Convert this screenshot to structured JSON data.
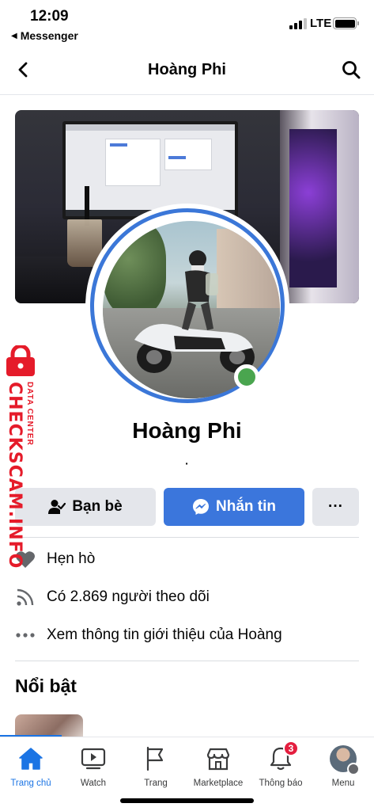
{
  "status_bar": {
    "time": "12:09",
    "back_app": "Messenger",
    "network": "LTE"
  },
  "header": {
    "title": "Hoàng Phi"
  },
  "profile": {
    "name": "Hoàng Phi",
    "separator": "·",
    "online": true,
    "accent_color": "#3b77d8",
    "online_color": "#4aa54f"
  },
  "actions": {
    "friends_label": "Bạn bè",
    "message_label": "Nhắn tin",
    "more_label": "···"
  },
  "info": [
    {
      "icon": "heart-icon",
      "text": "Hẹn hò"
    },
    {
      "icon": "rss-icon",
      "text": "Có 2.869 người theo dõi"
    },
    {
      "icon": "more-dots-icon",
      "text": "Xem thông tin giới thiệu của Hoàng"
    }
  ],
  "highlights": {
    "title": "Nổi bật"
  },
  "bottom_nav": [
    {
      "icon": "home-icon",
      "label": "Trang chủ",
      "active": true
    },
    {
      "icon": "watch-icon",
      "label": "Watch"
    },
    {
      "icon": "flag-icon",
      "label": "Trang"
    },
    {
      "icon": "store-icon",
      "label": "Marketplace"
    },
    {
      "icon": "bell-icon",
      "label": "Thông báo",
      "badge": "3"
    },
    {
      "icon": "avatar-icon",
      "label": "Menu"
    }
  ],
  "watermark": {
    "brand": "CHECKSCAM.INFO",
    "subtitle": "DATA CENTER"
  },
  "colors": {
    "primary": "#1b74e4",
    "button_blue": "#3b76dc",
    "badge_red": "#e41e3f"
  }
}
